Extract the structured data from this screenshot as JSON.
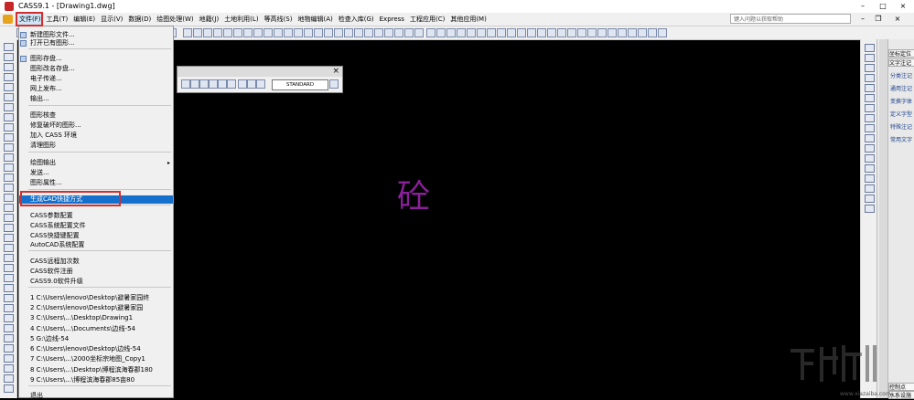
{
  "title_bar": {
    "title": "CASS9.1 - [Drawing1.dwg]",
    "minimize": "–",
    "restore": "□",
    "close": "×"
  },
  "menu_bar": {
    "items": [
      "文件(F)",
      "工具(T)",
      "编辑(E)",
      "显示(V)",
      "数据(D)",
      "绘图处理(W)",
      "地籍(J)",
      "土地利用(L)",
      "等高线(S)",
      "地物编辑(A)",
      "检查入库(G)",
      "Express",
      "工程应用(C)",
      "其他应用(M)"
    ],
    "help_placeholder": "键入问题以获取帮助",
    "mdi_minimize": "–",
    "mdi_restore": "❐",
    "mdi_close": "×"
  },
  "floating_toolbar": {
    "style_value": "STANDARD",
    "close": "×"
  },
  "file_menu": {
    "items": [
      "新建图形文件...",
      "打开已有图形...",
      "图形存盘...",
      "图形改名存盘...",
      "电子传递...",
      "网上发布...",
      "输出...",
      "图形核查",
      "修复破坏的图形...",
      "加入 CASS 环境",
      "清理图形",
      "绘图输出",
      "发送...",
      "图形属性...",
      "生成CAD快捷方式",
      "CASS参数配置",
      "CASS系统配置文件",
      "CASS快捷键配置",
      "AutoCAD系统配置",
      "CASS远程加次数",
      "CASS软件注册",
      "CASS9.0软件升级",
      "1 C:\\Users\\lenovo\\Desktop\\避暑家园终",
      "2 C:\\Users\\lenovo\\Desktop\\避暑家园",
      "3 C:\\Users\\...\\Desktop\\Drawing1",
      "4 C:\\Users\\...\\Documents\\边线-54",
      "5 G:\\边线-54",
      "6 C:\\Users\\lenovo\\Desktop\\边线-54",
      "7 C:\\Users\\...\\2000坐标宗地图_Copy1",
      "8 C:\\Users\\...\\Desktop\\博程滨海春郡180",
      "9 C:\\Users\\...\\博程滨海春郡85亩80",
      "退出"
    ],
    "highlighted_index": 14,
    "submenu_arrow": "▸"
  },
  "canvas": {
    "glyph": "砼"
  },
  "right_panel": {
    "tabs": [
      "坐标定位",
      "文字注记"
    ],
    "entries": [
      "分类注记",
      "通用注记",
      "变换字体",
      "定义字型",
      "特殊注记",
      "常用文字"
    ],
    "bottom_tab": "控制点",
    "bottom_tab_2": "水系设施"
  },
  "watermark": {
    "text": "下载",
    "subtext": "www.xiazaiba.com"
  },
  "colors": {
    "highlight": "#1470cc",
    "annotation_red": "#d32f2f",
    "canvas": "#000000",
    "glyph": "#8a1f9a"
  }
}
